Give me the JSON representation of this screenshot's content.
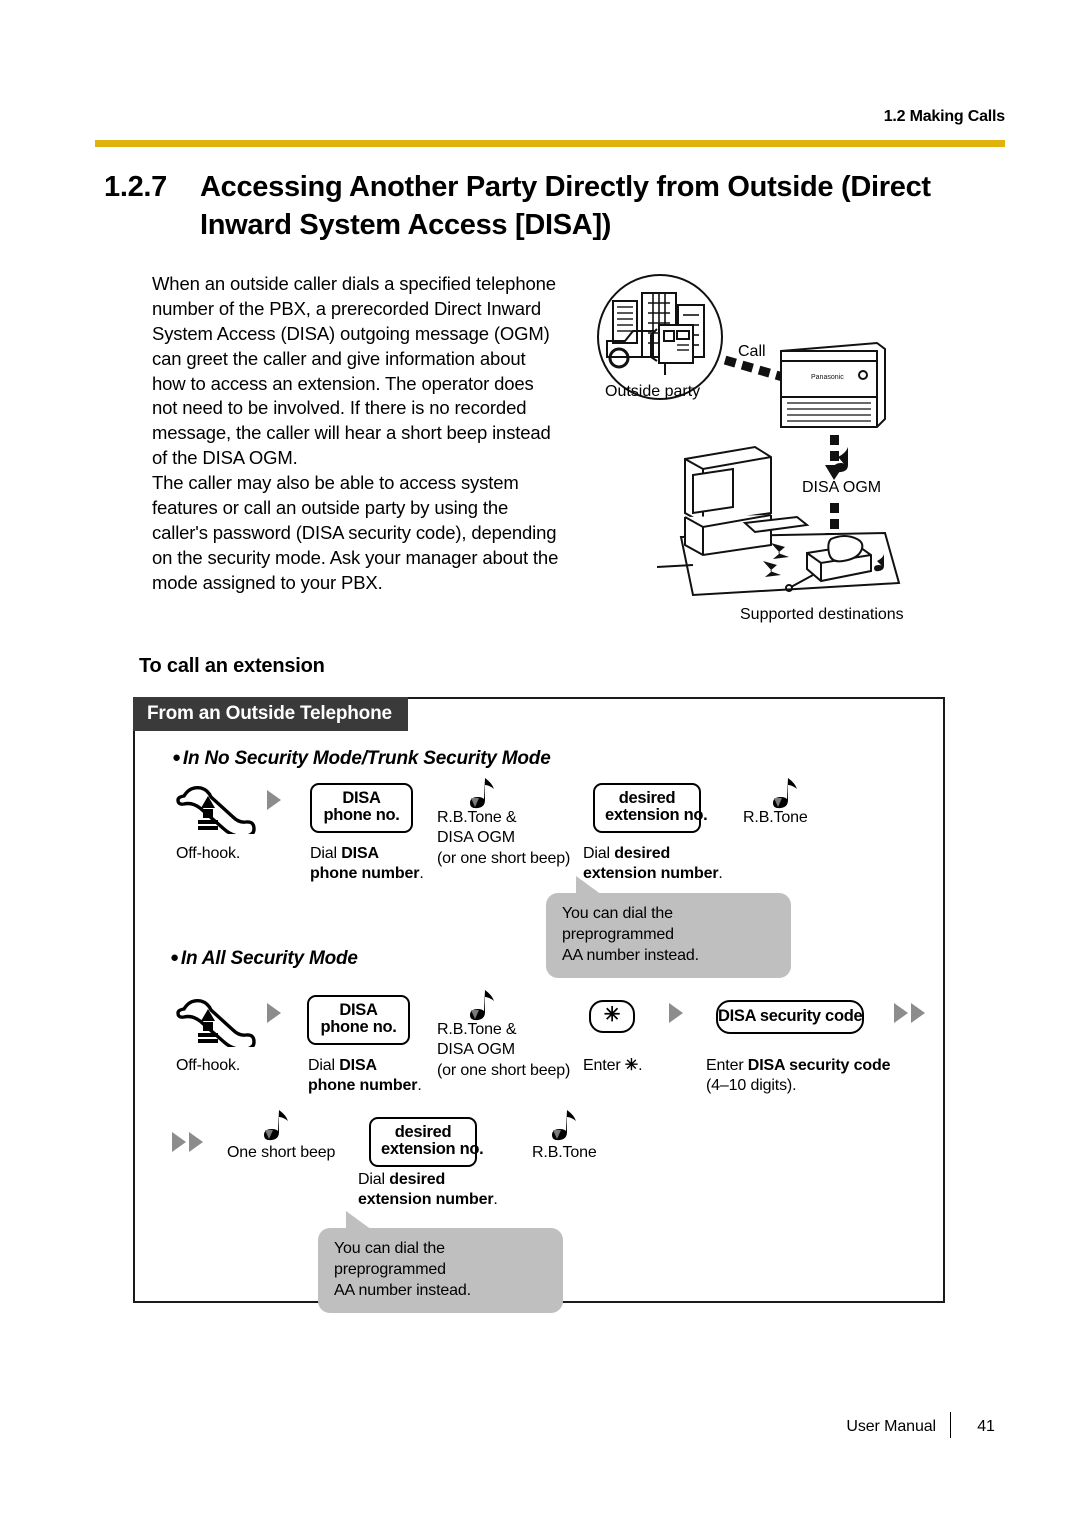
{
  "page": {
    "running_header": "1.2 Making Calls",
    "rule_color": "#e0b20d",
    "footer_label": "User Manual",
    "page_number": "41"
  },
  "section": {
    "number": "1.2.7",
    "title": "Accessing Another Party Directly from Outside (Direct Inward System Access [DISA])"
  },
  "intro": {
    "paragraph_1": "When an outside caller dials a specified telephone number of the PBX, a prerecorded Direct Inward System Access (DISA) outgoing message (OGM) can greet the caller and give information about how to access an extension. The operator does not need to be involved. If there is no recorded message, the caller will hear a short beep instead of the DISA OGM.",
    "paragraph_2": "The caller may also be able to access system features or call an outside party by using the caller's password (DISA security code), depending on the security mode. Ask your manager about the mode assigned to your PBX."
  },
  "illustration": {
    "outside_party": "Outside party",
    "call": "Call",
    "disa_ogm": "DISA OGM",
    "supported_destinations": "Supported destinations"
  },
  "procedure": {
    "subheading": "To call an extension",
    "box_tab": "From an Outside Telephone",
    "mode_1": {
      "heading": "In No Security Mode/Trunk Security Mode",
      "steps": [
        {
          "icon": "offhook-handset-icon",
          "caption": "Off-hook."
        },
        {
          "key": "DISA\nphone no.",
          "key_line1": "DISA",
          "key_line2": "phone no.",
          "caption_plain": "Dial ",
          "caption_bold": "DISA",
          "caption_bold_2": "phone number",
          "caption_tail": "."
        },
        {
          "tone_line1": "R.B.Tone &",
          "tone_line2": "DISA OGM",
          "tone_line3": "(or one short beep)"
        },
        {
          "key_line1": "desired",
          "key_line2": "extension no.",
          "caption_plain": "Dial ",
          "caption_bold": "desired",
          "caption_bold_2": "extension number",
          "caption_tail": "."
        },
        {
          "tone_line1": "R.B.Tone"
        }
      ],
      "balloon": "You can dial the preprogrammed AA number instead.",
      "balloon_line1": "You can dial the preprogrammed",
      "balloon_line2": "AA number instead."
    },
    "mode_2": {
      "heading": "In All Security Mode",
      "steps_row1": [
        {
          "icon": "offhook-handset-icon",
          "caption": "Off-hook."
        },
        {
          "key_line1": "DISA",
          "key_line2": "phone no.",
          "caption_plain": "Dial ",
          "caption_bold": "DISA",
          "caption_bold_2": "phone number",
          "caption_tail": "."
        },
        {
          "tone_line1": "R.B.Tone &",
          "tone_line2": "DISA OGM",
          "tone_line3": "(or one short beep)"
        },
        {
          "key_line1": "✳",
          "caption_plain": "Enter ",
          "caption_bold": "✳",
          "caption_tail": "."
        },
        {
          "key_line1": "DISA security code",
          "caption_plain": "Enter ",
          "caption_bold": "DISA security code",
          "caption_line2": "(4–10 digits)."
        }
      ],
      "steps_row2": [
        {
          "tone_line1": "One short beep"
        },
        {
          "key_line1": "desired",
          "key_line2": "extension no.",
          "caption_plain": "Dial ",
          "caption_bold": "desired",
          "caption_bold_2": "extension number",
          "caption_tail": "."
        },
        {
          "tone_line1": "R.B.Tone"
        }
      ],
      "balloon_line1": "You can dial the preprogrammed",
      "balloon_line2": "AA number instead."
    }
  }
}
